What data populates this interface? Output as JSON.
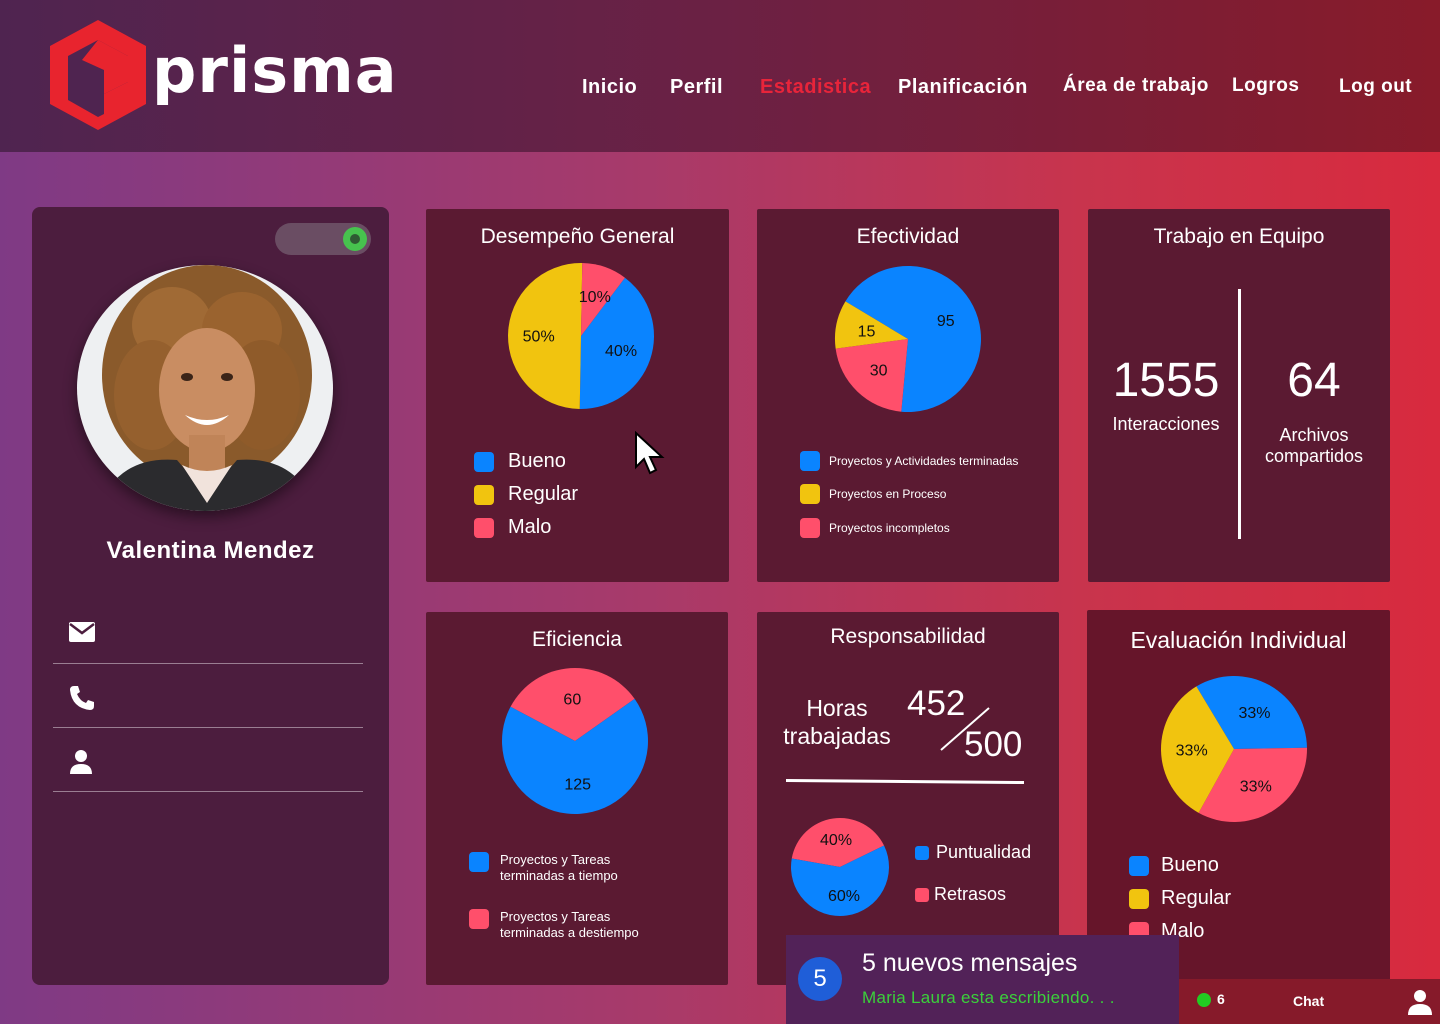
{
  "brand": {
    "name": "prisma"
  },
  "nav": {
    "items": [
      {
        "label": "Inicio",
        "active": false
      },
      {
        "label": "Perfil",
        "active": false
      },
      {
        "label": "Estadistica",
        "active": true
      },
      {
        "label": "Planificación",
        "active": false
      },
      {
        "label": "Área de trabajo",
        "active": false
      },
      {
        "label": "Logros",
        "active": false
      },
      {
        "label": "Log out",
        "active": false
      }
    ]
  },
  "profile": {
    "name": "Valentina Mendez",
    "toggle_on": true,
    "contact_icons": [
      "mail-icon",
      "phone-icon",
      "user-icon"
    ]
  },
  "colors": {
    "blue": "#0a84ff",
    "yellow": "#f1c40f",
    "red": "#ff4f6b",
    "active_nav": "#e8243a",
    "online": "#22cc22"
  },
  "cards": {
    "desempeno": {
      "title": "Desempeño General",
      "legend": [
        "Bueno",
        "Regular",
        "Malo"
      ]
    },
    "efectividad": {
      "title": "Efectividad",
      "legend": [
        "Proyectos y Actividades terminadas",
        "Proyectos en Proceso",
        "Proyectos incompletos"
      ]
    },
    "equipo": {
      "title": "Trabajo en Equipo",
      "interacciones_value": "1555",
      "interacciones_label": "Interacciones",
      "archivos_value": "64",
      "archivos_label_1": "Archivos",
      "archivos_label_2": "compartidos"
    },
    "eficiencia": {
      "title": "Eficiencia",
      "legend_1_a": "Proyectos y Tareas",
      "legend_1_b": "terminadas a tiempo",
      "legend_2_a": "Proyectos y Tareas",
      "legend_2_b": "terminadas a destiempo"
    },
    "responsabilidad": {
      "title": "Responsabilidad",
      "horas_label_1": "Horas",
      "horas_label_2": "trabajadas",
      "horas_value": "452",
      "horas_total": "500",
      "legend": [
        "Puntualidad",
        "Retrasos"
      ]
    },
    "evaluacion": {
      "title": "Evaluación Individual",
      "legend": [
        "Bueno",
        "Regular",
        "Malo"
      ]
    }
  },
  "chart_data": [
    {
      "type": "pie",
      "title": "Desempeño General",
      "labels": [
        "Bueno",
        "Regular",
        "Malo"
      ],
      "values": [
        40,
        50,
        10
      ],
      "value_labels": [
        "40%",
        "50%",
        "10%"
      ]
    },
    {
      "type": "pie",
      "title": "Efectividad",
      "labels": [
        "Proyectos y Actividades terminadas",
        "Proyectos en Proceso",
        "Proyectos incompletos"
      ],
      "values": [
        95,
        15,
        30
      ],
      "value_labels": [
        "95",
        "15",
        "30"
      ]
    },
    {
      "type": "pie",
      "title": "Eficiencia",
      "labels": [
        "Proyectos y Tareas terminadas a tiempo",
        "Proyectos y Tareas terminadas a destiempo"
      ],
      "values": [
        125,
        60
      ],
      "value_labels": [
        "125",
        "60"
      ]
    },
    {
      "type": "pie",
      "title": "Responsabilidad",
      "labels": [
        "Puntualidad",
        "Retrasos"
      ],
      "values": [
        60,
        40
      ],
      "value_labels": [
        "60%",
        "40%"
      ]
    },
    {
      "type": "pie",
      "title": "Evaluación Individual",
      "labels": [
        "Bueno",
        "Regular",
        "Malo"
      ],
      "values": [
        33,
        33,
        33
      ],
      "value_labels": [
        "33%",
        "33%",
        "33%"
      ]
    }
  ],
  "notification": {
    "count": "5",
    "title": "5 nuevos mensajes",
    "subtitle": "Maria Laura esta escribiendo. . ."
  },
  "chat": {
    "online_count": "6",
    "label": "Chat"
  }
}
